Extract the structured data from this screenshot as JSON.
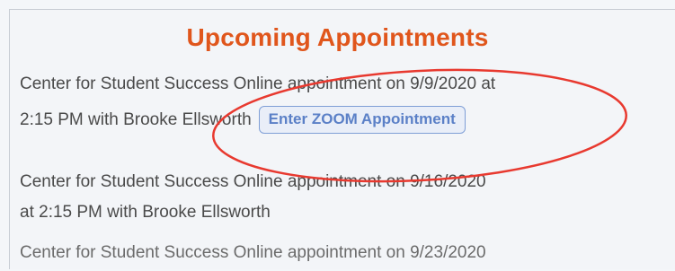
{
  "header": {
    "title": "Upcoming Appointments"
  },
  "appointments": [
    {
      "line1": "Center for Student Success Online appointment on 9/9/2020 at",
      "line2": "2:15 PM with Brooke Ellsworth",
      "button_label": "Enter ZOOM Appointment"
    },
    {
      "line1": "Center for Student Success Online appointment on 9/16/2020",
      "line2": "at 2:15 PM with Brooke Ellsworth"
    },
    {
      "line1": "Center for Student Success Online appointment on 9/23/2020"
    }
  ],
  "colors": {
    "title": "#e0561c",
    "annotation_ellipse": "#e8392f",
    "button_text": "#5b80c7"
  }
}
